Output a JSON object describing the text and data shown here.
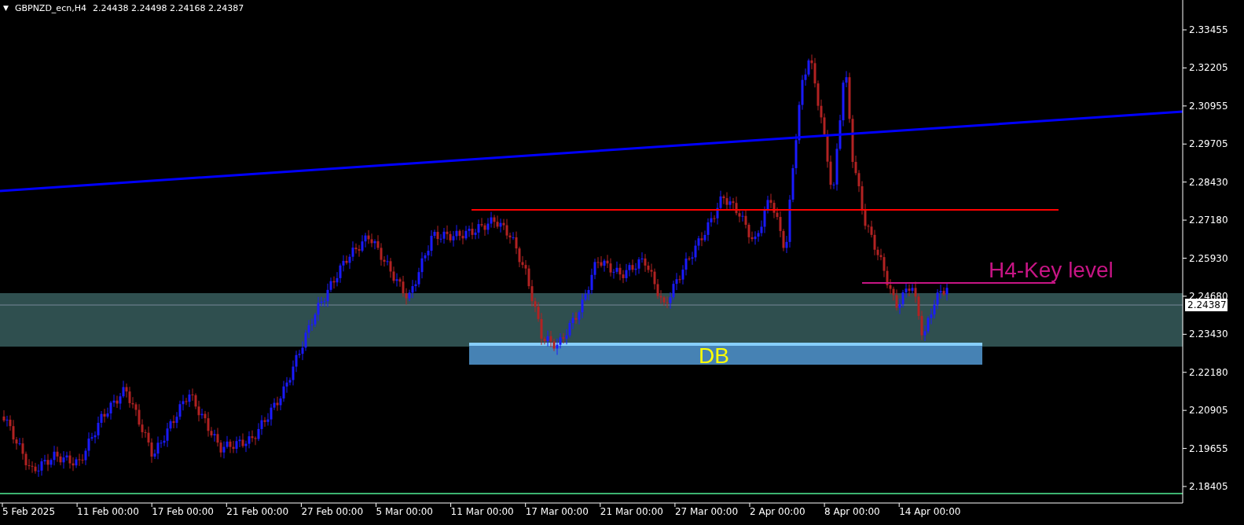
{
  "chart_header": {
    "menu_arrow": "▼",
    "symbol": "GBPNZD_ecn,H4",
    "quotes": "2.24438 2.24498 2.24168 2.24387"
  },
  "price_axis": {
    "ticks": [
      "2.33455",
      "2.32205",
      "2.30955",
      "2.29705",
      "2.28430",
      "2.27180",
      "2.25930",
      "2.24680",
      "2.23430",
      "2.22180",
      "2.20905",
      "2.19655",
      "2.18405"
    ],
    "current_price": "2.24387"
  },
  "time_axis": {
    "labels": [
      "5 Feb 2025",
      "11 Feb 00:00",
      "17 Feb 00:00",
      "21 Feb 00:00",
      "27 Feb 00:00",
      "5 Mar 00:00",
      "11 Mar 00:00",
      "17 Mar 00:00",
      "21 Mar 00:00",
      "27 Mar 00:00",
      "2 Apr 00:00",
      "8 Apr 00:00",
      "14 Apr 00:00"
    ]
  },
  "annotations": {
    "key_level_label": "H4-Key level",
    "zone_label": "DB"
  }
}
